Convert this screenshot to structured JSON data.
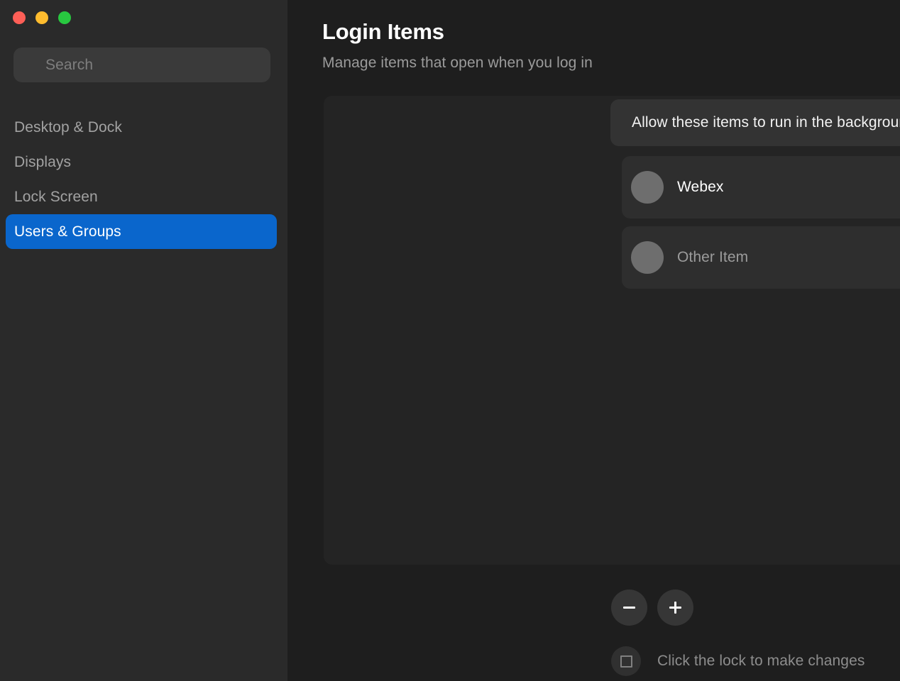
{
  "window": {
    "traffic_lights": [
      {
        "name": "close",
        "color": "#fe5f57"
      },
      {
        "name": "minimize",
        "color": "#febc2e"
      },
      {
        "name": "maximize",
        "color": "#28c840"
      }
    ]
  },
  "sidebar": {
    "search": {
      "placeholder": "Search",
      "value": ""
    },
    "items": [
      {
        "label": "Desktop & Dock",
        "selected": false
      },
      {
        "label": "Displays",
        "selected": false
      },
      {
        "label": "Lock Screen",
        "selected": false
      },
      {
        "label": "Users & Groups",
        "selected": true
      }
    ]
  },
  "main": {
    "title": "Login Items",
    "subtitle": "Manage items that open when you log in",
    "group_header": "Allow these items to run in the background:",
    "items": [
      {
        "label": "Webex",
        "enabled": true,
        "icon": "app-icon-placeholder"
      },
      {
        "label": "Other Item",
        "enabled": false,
        "icon": "app-icon-placeholder"
      }
    ],
    "actions": {
      "remove_label": "−",
      "add_label": "+"
    },
    "lock": {
      "text": "Click the lock to make changes",
      "icon": "lock-icon"
    }
  },
  "colors": {
    "accent": "#0a66cc",
    "sidebar_bg": "#2a2a2a",
    "content_bg": "#1e1e1e",
    "panel_bg": "#242424",
    "row_bg": "#2e2e2e",
    "header_bar_bg": "#333333",
    "toggle_off": "#4a4a4a",
    "icon_placeholder": "#6e6e6e"
  }
}
